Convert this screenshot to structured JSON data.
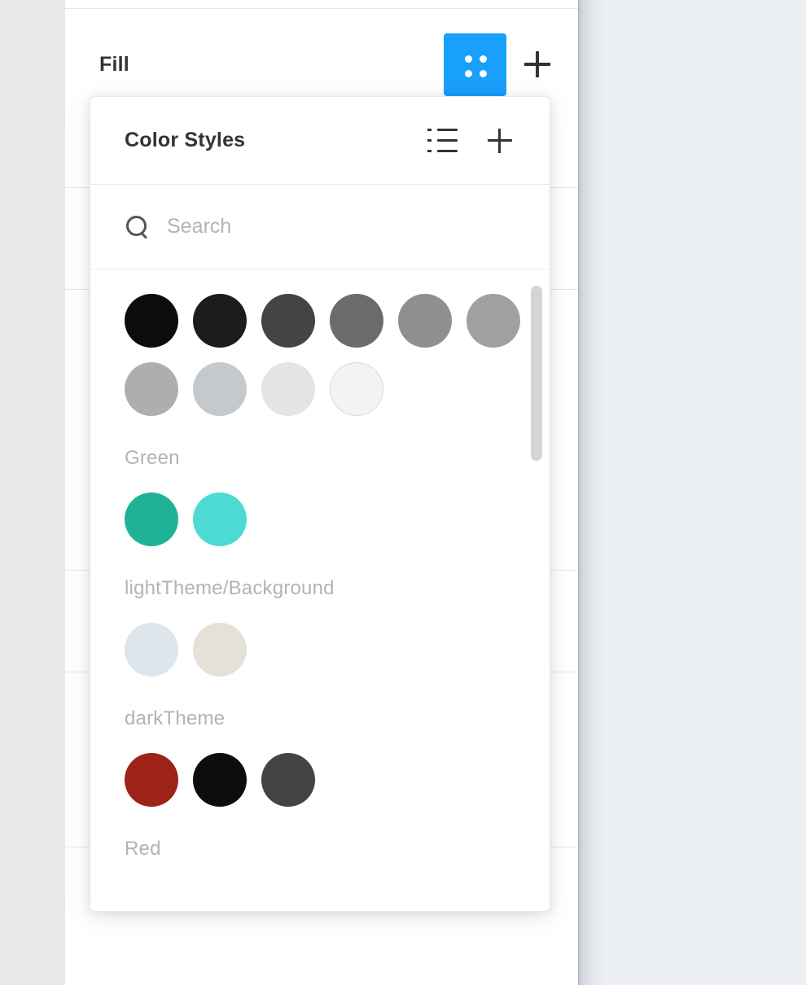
{
  "theme": {
    "accent": "#18a0fb",
    "panel_bg": "#ffffff",
    "app_bg": "#e8e8e8",
    "canvas_bg": "#eceff3",
    "divider": "#e6e6e6",
    "label_muted": "#b0b3b8",
    "text_dark": "#333333"
  },
  "panel": {
    "fill_section": {
      "label": "Fill",
      "styles_button_name": "styles-button",
      "add_button_name": "add-fill-button"
    },
    "divider_positions": [
      10,
      230,
      355,
      700,
      825,
      1040
    ]
  },
  "popover": {
    "title": "Color Styles",
    "list_view_icon": "list-view-icon",
    "add_style_icon": "plus-icon",
    "search": {
      "placeholder": "Search",
      "value": "",
      "icon": "search-icon"
    },
    "groups": [
      {
        "label": "",
        "swatches": [
          {
            "color": "#0c0c0c",
            "ring": false
          },
          {
            "color": "#1c1c1c",
            "ring": false
          },
          {
            "color": "#444444",
            "ring": false
          },
          {
            "color": "#6b6b6b",
            "ring": false
          },
          {
            "color": "#8f8f8f",
            "ring": false
          },
          {
            "color": "#a0a0a0",
            "ring": false
          },
          {
            "color": "#aeaeae",
            "ring": false
          },
          {
            "color": "#c6c9cc",
            "ring": false
          },
          {
            "color": "#e2e4e6",
            "ring": false
          },
          {
            "color": "#f2f3f2",
            "ring": true
          }
        ]
      },
      {
        "label": "Green",
        "swatches": [
          {
            "color": "#20b294",
            "ring": false
          },
          {
            "color": "#4ddad3",
            "ring": false
          }
        ]
      },
      {
        "label": "lightTheme/Background",
        "swatches": [
          {
            "color": "#dde6ed",
            "ring": false
          },
          {
            "color": "#e5e1d8",
            "ring": false
          }
        ]
      },
      {
        "label": "darkTheme",
        "swatches": [
          {
            "color": "#9d2218",
            "ring": false
          },
          {
            "color": "#0d0d0d",
            "ring": false
          },
          {
            "color": "#444444",
            "ring": false
          },
          {
            "color": "#11archived",
            "ring": false
          }
        ]
      },
      {
        "label": "Red",
        "swatches": []
      }
    ],
    "scrollbar": {
      "name": "styles-scrollbar"
    }
  }
}
